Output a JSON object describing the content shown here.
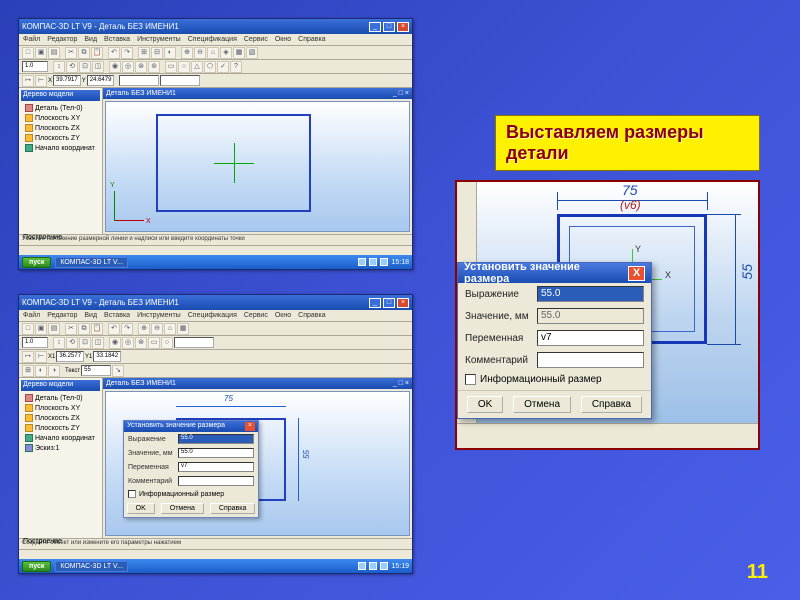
{
  "callout": "Выставляем  размеры детали",
  "page_number": "11",
  "app": {
    "title": "КОМПАС-3D LT V9 - Деталь БЕЗ ИМЕНИ1",
    "menu": [
      "Файл",
      "Редактор",
      "Вид",
      "Вставка",
      "Инструменты",
      "Спецификация",
      "Сервис",
      "Окно",
      "Справка"
    ],
    "doc_title": "Деталь БЕЗ ИМЕНИ1",
    "side_header": "Дерево модели",
    "tree": [
      {
        "icon": "p",
        "label": "Деталь (Тел-0)"
      },
      {
        "icon": "o",
        "label": "Плоскость XY"
      },
      {
        "icon": "o",
        "label": "Плоскость ZX"
      },
      {
        "icon": "o",
        "label": "Плоскость ZY"
      },
      {
        "icon": "",
        "label": "Начало координат"
      },
      {
        "icon": "",
        "label": "Эскиз:1"
      }
    ],
    "coords": {
      "x": "39.7917",
      "y": "24.6479"
    },
    "coords2": {
      "x": "36.2577",
      "y": "33.1842"
    },
    "status_a": "Укажите положение размерной линии и надписи или введите координаты  точки",
    "status_b": "Создайте объект или измените его параметры нажатием",
    "side_bottom": "Построение",
    "dim_small": {
      "top": "75",
      "side": "55"
    },
    "input_label": "Текст",
    "input_val": "55",
    "taskbar": {
      "start": "пуск",
      "task": "КОМПАС-3D LT V...",
      "time": "15:19",
      "time2": "15:18"
    }
  },
  "dialog": {
    "title": "Установить значение размера",
    "rows": {
      "expr_label": "Выражение",
      "expr_val": "55.0",
      "value_label": "Значение, мм",
      "value_val": "55.0",
      "var_label": "Переменная",
      "var_val": "v7",
      "comment_label": "Комментарий",
      "comment_val": ""
    },
    "checkbox": "Информационный размер",
    "buttons": {
      "ok": "OK",
      "cancel": "Отмена",
      "help": "Справка"
    }
  },
  "detail": {
    "dim_top": "75",
    "dim_top_red": "(v6)",
    "dim_side": "55"
  }
}
